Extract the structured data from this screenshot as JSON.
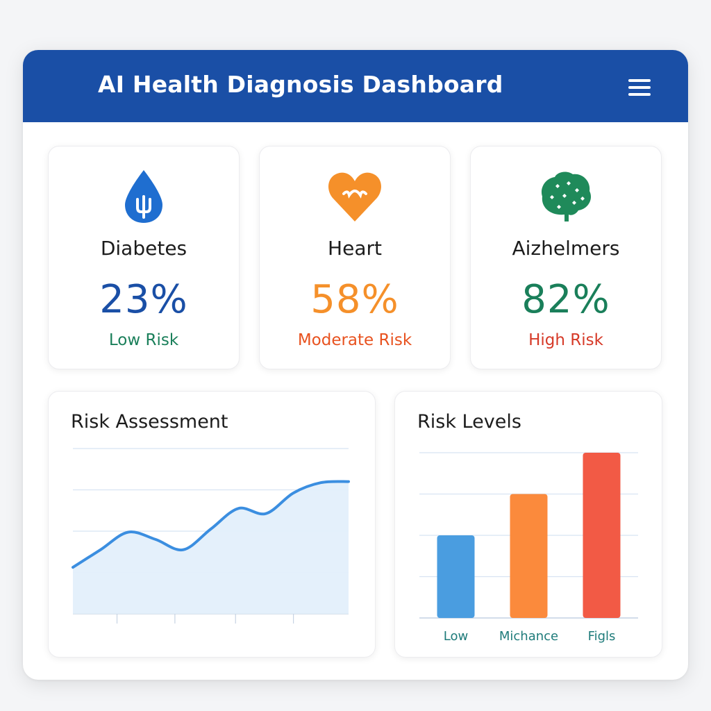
{
  "header": {
    "title": "AI Health Diagnosis Dashboard",
    "menu_icon": "hamburger-menu-icon",
    "bg_color": "#1a4fa6"
  },
  "stats": [
    {
      "label": "Diabetes",
      "value": "23%",
      "risk": "Low Risk",
      "icon": "blood-drop-icon",
      "value_color": "#1a4fa6",
      "risk_color": "#1a7f5a"
    },
    {
      "label": "Heart",
      "value": "58%",
      "risk": "Moderate Risk",
      "icon": "heart-icon",
      "value_color": "#f5902a",
      "risk_color": "#e8521f"
    },
    {
      "label": "Aizhelmers",
      "value": "82%",
      "risk": "High Risk",
      "icon": "brain-icon",
      "value_color": "#1a7f5a",
      "risk_color": "#d63a28"
    }
  ],
  "risk_assessment": {
    "title": "Risk Assessment",
    "chart_data": {
      "type": "area",
      "x": [
        0,
        1,
        2,
        3,
        4,
        5,
        6,
        7,
        8,
        9,
        10
      ],
      "values": [
        45,
        62,
        79,
        72,
        62,
        82,
        102,
        97,
        117,
        127,
        128
      ],
      "ylim": [
        0,
        160
      ],
      "grid": true,
      "color": "#3b8ee0"
    }
  },
  "risk_levels": {
    "title": "Risk Levels",
    "chart_data": {
      "type": "bar",
      "categories": [
        "Low",
        "Michance",
        "Figls"
      ],
      "values": [
        50,
        75,
        100
      ],
      "ylim": [
        0,
        100
      ],
      "grid": true,
      "colors": [
        "#4a9de0",
        "#fb8a3c",
        "#f25a45"
      ]
    }
  }
}
